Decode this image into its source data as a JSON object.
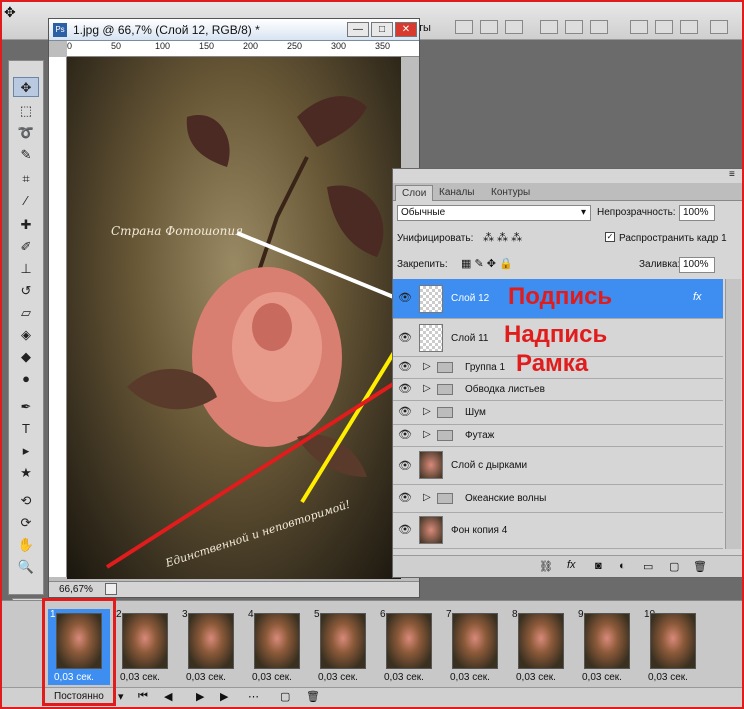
{
  "app": {
    "tool_label": "ты"
  },
  "doc": {
    "title": "1.jpg @ 66,7% (Слой 12, RGB/8) *",
    "zoom": "66,67%",
    "ruler": [
      "0",
      "50",
      "100",
      "150",
      "200",
      "250",
      "300",
      "350",
      "400",
      "450",
      "50"
    ],
    "canvas_text_top": "Страна Фотошопия",
    "canvas_text_bottom": "Единственной и неповторимой!"
  },
  "layers_panel": {
    "tabs": [
      "Слои",
      "Каналы",
      "Контуры"
    ],
    "blend_mode": "Обычные",
    "opacity_label": "Непрозрачность:",
    "opacity_value": "100%",
    "unify_label": "Унифицировать:",
    "propagate_label": "Распространить кадр 1",
    "lock_label": "Закрепить:",
    "fill_label": "Заливка:",
    "fill_value": "100%",
    "layers": [
      {
        "name": "Слой 12",
        "kind": "empty",
        "selected": true
      },
      {
        "name": "Слой 11",
        "kind": "empty"
      },
      {
        "name": "Группа 1",
        "kind": "group"
      },
      {
        "name": "Обводка листьев",
        "kind": "group"
      },
      {
        "name": "Шум",
        "kind": "group"
      },
      {
        "name": "Футаж",
        "kind": "group"
      },
      {
        "name": "Слой с дырками",
        "kind": "image"
      },
      {
        "name": "Океанские волны",
        "kind": "group"
      },
      {
        "name": "Фон копия 4",
        "kind": "image"
      }
    ]
  },
  "annotations": {
    "podpis": "Подпись",
    "nadpis": "Надпись",
    "ramka": "Рамка"
  },
  "animation": {
    "loop": "Постоянно",
    "frames": [
      {
        "num": "1",
        "delay": "0,03 сек."
      },
      {
        "num": "2",
        "delay": "0,03 сек."
      },
      {
        "num": "3",
        "delay": "0,03 сек."
      },
      {
        "num": "4",
        "delay": "0,03 сек."
      },
      {
        "num": "5",
        "delay": "0,03 сек."
      },
      {
        "num": "6",
        "delay": "0,03 сек."
      },
      {
        "num": "7",
        "delay": "0,03 сек."
      },
      {
        "num": "8",
        "delay": "0,03 сек."
      },
      {
        "num": "9",
        "delay": "0,03 сек."
      },
      {
        "num": "10",
        "delay": "0,03 сек."
      }
    ]
  },
  "colors": {
    "accent": "#3d8ef0",
    "annotation": "#e01c1c",
    "line_yellow": "#ffee00"
  }
}
